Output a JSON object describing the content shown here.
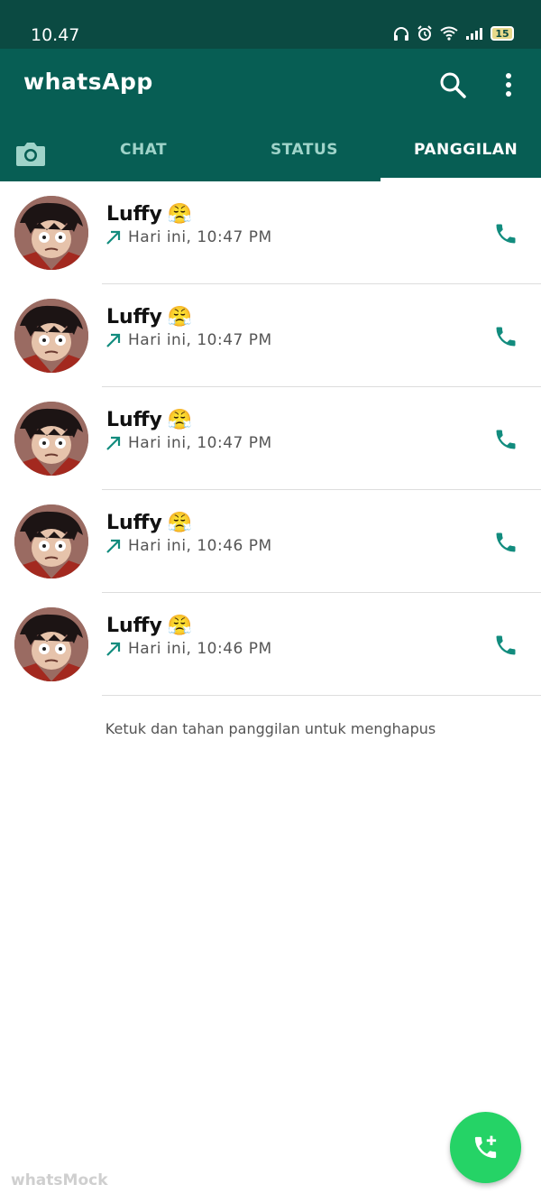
{
  "status_bar": {
    "time": "10.47",
    "battery": "15"
  },
  "app_bar": {
    "title": "whatsApp"
  },
  "tabs": [
    {
      "label": "CHAT",
      "active": false
    },
    {
      "label": "STATUS",
      "active": false
    },
    {
      "label": "PANGGILAN",
      "active": true
    }
  ],
  "calls": [
    {
      "name": "Luffy",
      "emoji": "😤",
      "direction": "outgoing",
      "time": "Hari ini, 10:47 PM"
    },
    {
      "name": "Luffy",
      "emoji": "😤",
      "direction": "outgoing",
      "time": "Hari ini, 10:47 PM"
    },
    {
      "name": "Luffy",
      "emoji": "😤",
      "direction": "outgoing",
      "time": "Hari ini, 10:47 PM"
    },
    {
      "name": "Luffy",
      "emoji": "😤",
      "direction": "outgoing",
      "time": "Hari ini, 10:46 PM"
    },
    {
      "name": "Luffy",
      "emoji": "😤",
      "direction": "outgoing",
      "time": "Hari ini, 10:46 PM"
    }
  ],
  "hint": "Ketuk dan tahan panggilan untuk menghapus",
  "watermark": "whatsMock",
  "colors": {
    "header": "#075e54",
    "status_bar": "#0b4a42",
    "accent": "#128c7e",
    "fab": "#25d366"
  },
  "icons": [
    "search-icon",
    "more-vert-icon",
    "camera-icon",
    "outgoing-call-arrow-icon",
    "phone-icon",
    "add-call-icon"
  ]
}
